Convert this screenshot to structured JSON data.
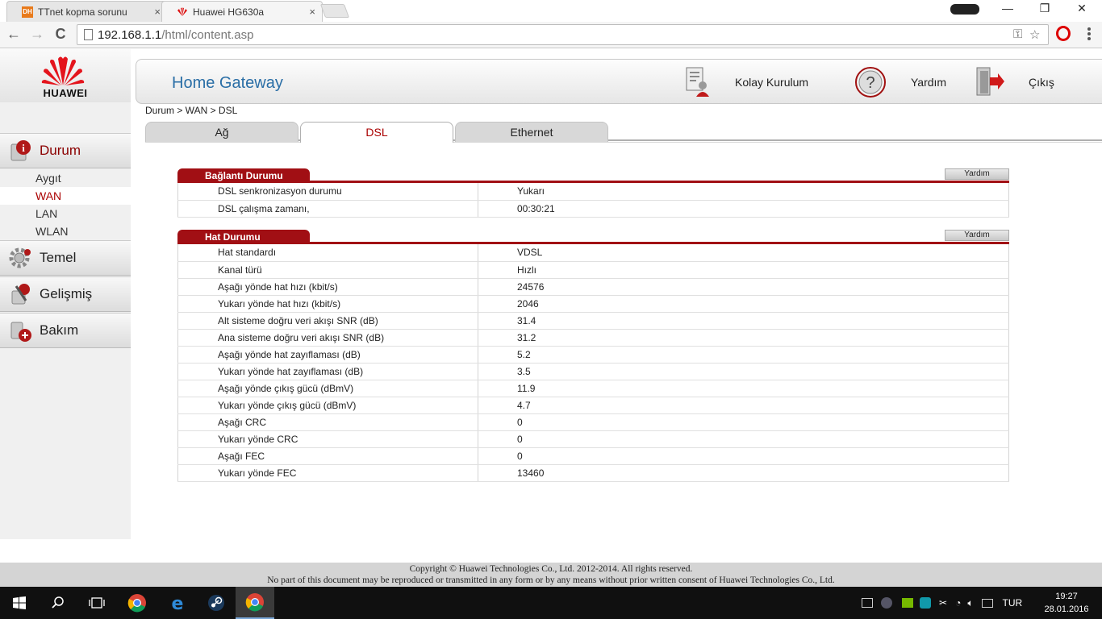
{
  "browser": {
    "tabs": [
      {
        "favicon_text": "DH",
        "title": "TTnet kopma sorunu",
        "close": "×",
        "active": false
      },
      {
        "favicon_text": "",
        "title": "Huawei HG630a",
        "close": "×",
        "active": true
      }
    ],
    "window_controls": {
      "minimize": "—",
      "restore": "❐",
      "close": "✕"
    },
    "toolbar": {
      "back": "←",
      "forward": "→",
      "reload": "C"
    },
    "address": {
      "host": "192.168.1.1",
      "path": "/html/content.asp"
    }
  },
  "router": {
    "brand": "HUAWEI",
    "header": {
      "title": "Home Gateway",
      "buttons": {
        "wizard": "Kolay Kurulum",
        "help": "Yardım",
        "logout": "Çıkış"
      }
    },
    "sidebar": {
      "status": {
        "label": "Durum",
        "items": [
          "Aygıt",
          "WAN",
          "LAN",
          "WLAN"
        ],
        "active_item": "WAN"
      },
      "basic": "Temel",
      "advanced": "Gelişmiş",
      "maintenance": "Bakım"
    },
    "breadcrumb": "Durum > WAN > DSL",
    "tabs": [
      "Ağ",
      "DSL",
      "Ethernet"
    ],
    "active_tab": "DSL",
    "connection": {
      "title": "Bağlantı Durumu",
      "help": "Yardım",
      "rows": [
        {
          "label": "DSL senkronizasyon durumu",
          "value": "Yukarı"
        },
        {
          "label": "DSL çalışma zamanı,",
          "value": "00:30:21"
        }
      ]
    },
    "line": {
      "title": "Hat Durumu",
      "help": "Yardım",
      "rows": [
        {
          "label": "Hat standardı",
          "value": "VDSL"
        },
        {
          "label": "Kanal türü",
          "value": "Hızlı"
        },
        {
          "label": "Aşağı yönde hat hızı (kbit/s)",
          "value": "24576"
        },
        {
          "label": "Yukarı yönde hat hızı (kbit/s)",
          "value": "2046"
        },
        {
          "label": "Alt sisteme doğru veri akışı SNR (dB)",
          "value": "31.4"
        },
        {
          "label": "Ana sisteme doğru veri akışı SNR (dB)",
          "value": "31.2"
        },
        {
          "label": "Aşağı yönde hat zayıflaması (dB)",
          "value": "5.2"
        },
        {
          "label": "Yukarı yönde hat zayıflaması (dB)",
          "value": "3.5"
        },
        {
          "label": "Aşağı yönde çıkış gücü (dBmV)",
          "value": "11.9"
        },
        {
          "label": "Yukarı yönde çıkış gücü (dBmV)",
          "value": "4.7"
        },
        {
          "label": "Aşağı CRC",
          "value": "0"
        },
        {
          "label": "Yukarı yönde CRC",
          "value": "0"
        },
        {
          "label": "Aşağı FEC",
          "value": "0"
        },
        {
          "label": "Yukarı yönde FEC",
          "value": "13460"
        }
      ]
    },
    "footer": {
      "line1": "Copyright © Huawei Technologies Co., Ltd. 2012-2014. All rights reserved.",
      "line2": "No part of this document may be reproduced or transmitted in any form or by any means without prior written consent of Huawei Technologies Co., Ltd."
    }
  },
  "taskbar": {
    "language": "TUR",
    "time": "19:27",
    "date": "28.01.2016",
    "pinned_icons": [
      "windows-start-icon",
      "search-icon",
      "task-view-icon",
      "chrome-icon",
      "edge-icon",
      "steam-icon",
      "chrome-icon"
    ]
  },
  "colors": {
    "brand_red": "#a10f14",
    "title_blue": "#2a6ea6",
    "active_text": "#a00"
  }
}
